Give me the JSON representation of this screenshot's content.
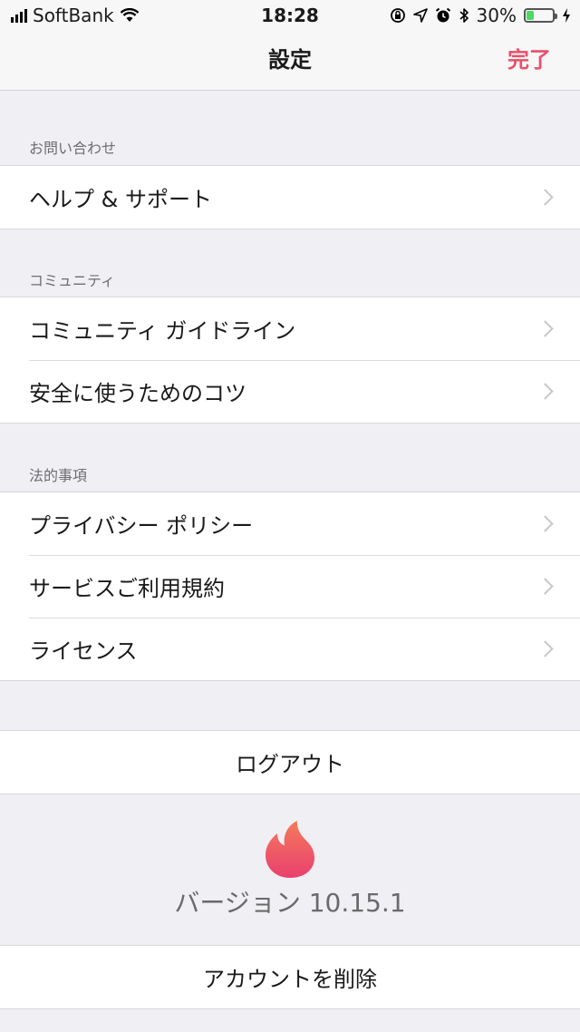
{
  "status_bar": {
    "carrier": "SoftBank",
    "time": "18:28",
    "battery_percent": "30%",
    "battery_level": 0.3,
    "icons": [
      "signal-icon",
      "wifi-icon",
      "rotation-lock-icon",
      "location-icon",
      "alarm-icon",
      "bluetooth-icon",
      "battery-icon",
      "charging-icon"
    ]
  },
  "nav": {
    "title": "設定",
    "done_label": "完了"
  },
  "sections": {
    "contact": {
      "header": "お問い合わせ",
      "items": [
        "ヘルプ & サポート"
      ]
    },
    "community": {
      "header": "コミュニティ",
      "items": [
        "コミュニティ ガイドライン",
        "安全に使うためのコツ"
      ]
    },
    "legal": {
      "header": "法的事項",
      "items": [
        "プライバシー ポリシー",
        "サービスご利用規約",
        "ライセンス"
      ]
    }
  },
  "logout_label": "ログアウト",
  "version_text": "バージョン 10.15.1",
  "delete_account_label": "アカウントを削除",
  "colors": {
    "accent": "#e9506a",
    "background": "#efeff4",
    "flame_top": "#f47a5c",
    "flame_bottom": "#e9406e"
  }
}
